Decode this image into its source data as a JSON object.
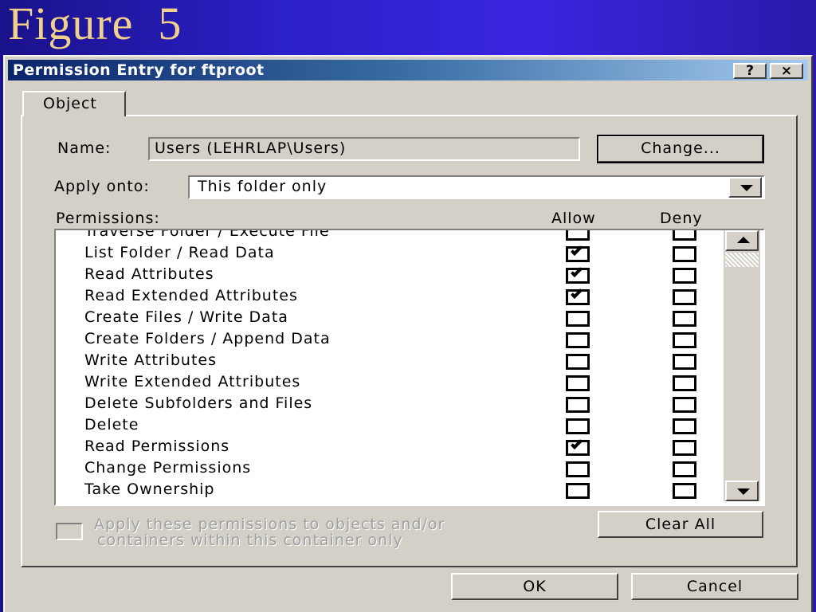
{
  "slide": {
    "title": "Figure  5"
  },
  "window": {
    "title": "Permission Entry for ftproot",
    "help_label": "?",
    "close_label": "×"
  },
  "tab": {
    "label": "Object"
  },
  "form": {
    "name_label": "Name:",
    "name_value": "Users (LEHRLAP\\Users)",
    "change_label": "Change...",
    "apply_onto_label": "Apply onto:",
    "apply_onto_value": "This folder only",
    "permissions_label": "Permissions:",
    "allow_header": "Allow",
    "deny_header": "Deny"
  },
  "permissions": [
    {
      "name": "Traverse Folder / Execute File",
      "allow": false,
      "deny": false
    },
    {
      "name": "List Folder / Read Data",
      "allow": true,
      "deny": false
    },
    {
      "name": "Read Attributes",
      "allow": true,
      "deny": false
    },
    {
      "name": "Read Extended Attributes",
      "allow": true,
      "deny": false
    },
    {
      "name": "Create Files / Write Data",
      "allow": false,
      "deny": false
    },
    {
      "name": "Create Folders / Append Data",
      "allow": false,
      "deny": false
    },
    {
      "name": "Write Attributes",
      "allow": false,
      "deny": false
    },
    {
      "name": "Write Extended Attributes",
      "allow": false,
      "deny": false
    },
    {
      "name": "Delete Subfolders and Files",
      "allow": false,
      "deny": false
    },
    {
      "name": "Delete",
      "allow": false,
      "deny": false
    },
    {
      "name": "Read Permissions",
      "allow": true,
      "deny": false
    },
    {
      "name": "Change Permissions",
      "allow": false,
      "deny": false
    },
    {
      "name": "Take Ownership",
      "allow": false,
      "deny": false
    }
  ],
  "apply_container": {
    "line1": "Apply these permissions to objects and/or",
    "line2": "containers within this container only",
    "checked": false
  },
  "buttons": {
    "clear_all": "Clear All",
    "ok": "OK",
    "cancel": "Cancel"
  }
}
